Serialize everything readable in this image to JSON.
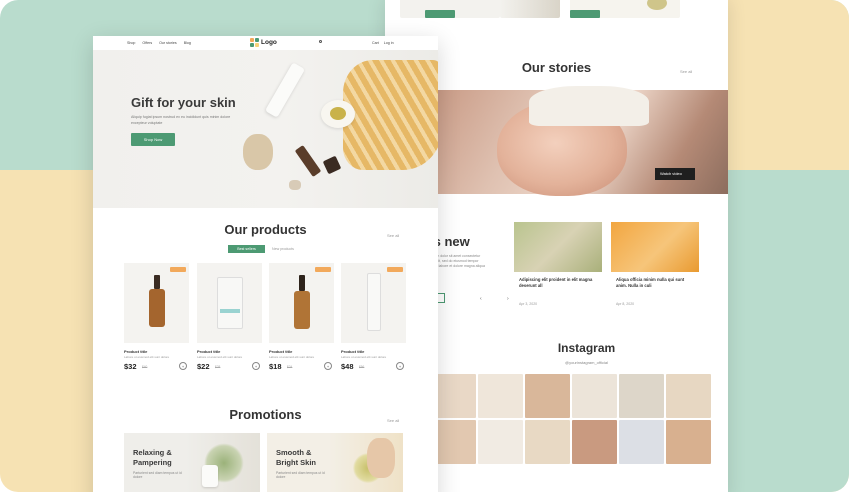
{
  "back_page": {
    "stories": {
      "title": "Our stories",
      "link": "See all",
      "button": "Watch video"
    },
    "whats_new": {
      "title": "at's new",
      "text": "Lorem ipsum dolor sit amet consectetur adipiscing elit, sed do eiusmod tempor incididunt ut labore et dolore magna aliqua",
      "button": "See all",
      "arrows": "‹ ›"
    },
    "news": [
      {
        "title": "Adipiscing elit proident in elit magna deserunt all",
        "date": "Apr 3, 2020"
      },
      {
        "title": "Aliqua officia minim nulla qui sunt anim. Nulla in culi",
        "date": "Apr 8, 2020"
      }
    ],
    "instagram": {
      "title": "Instagram",
      "handle": "@yourinstagram_official"
    }
  },
  "front_page": {
    "nav": {
      "links": [
        "Shop",
        "Offers",
        "Our stories",
        "Blog"
      ],
      "logo": "Logo",
      "right": [
        "Cart",
        "Log in"
      ]
    },
    "hero": {
      "title": "Gift for your skin",
      "text": "Aliquip fugiat ipsum nostrud ex eu incididunt quis minim dolore excepteur voluptate",
      "button": "Shop Now"
    },
    "products": {
      "title": "Our products",
      "link": "See all",
      "filters": [
        "Best sellers",
        "New products"
      ],
      "items": [
        {
          "name": "Product title",
          "desc": "Labore ut eiusmod elit sunt dolore",
          "price": "$32",
          "old_price": "$40"
        },
        {
          "name": "Product title",
          "desc": "Labore ut eiusmod elit sunt dolore",
          "price": "$22",
          "old_price": "$28"
        },
        {
          "name": "Product title",
          "desc": "Labore ut eiusmod elit sunt dolore",
          "price": "$18",
          "old_price": "$24"
        },
        {
          "name": "Product title",
          "desc": "Labore ut eiusmod elit sunt dolore",
          "price": "$48",
          "old_price": "$56"
        }
      ],
      "cart_icon": "+"
    },
    "promotions": {
      "title": "Promotions",
      "link": "See all",
      "items": [
        {
          "title_line1": "Relaxing &",
          "title_line2": "Pampering",
          "text": "Parturient sed diam tempus ut id dolore"
        },
        {
          "title_line1": "Smooth &",
          "title_line2": "Bright Skin",
          "text": "Parturient sed diam tempus ut id dolore"
        }
      ]
    }
  },
  "colors": {
    "accent": "#4d9a73",
    "tag": "#f2a95b",
    "mint_bg": "#b9dccd",
    "sand_bg": "#f6e2b3"
  }
}
